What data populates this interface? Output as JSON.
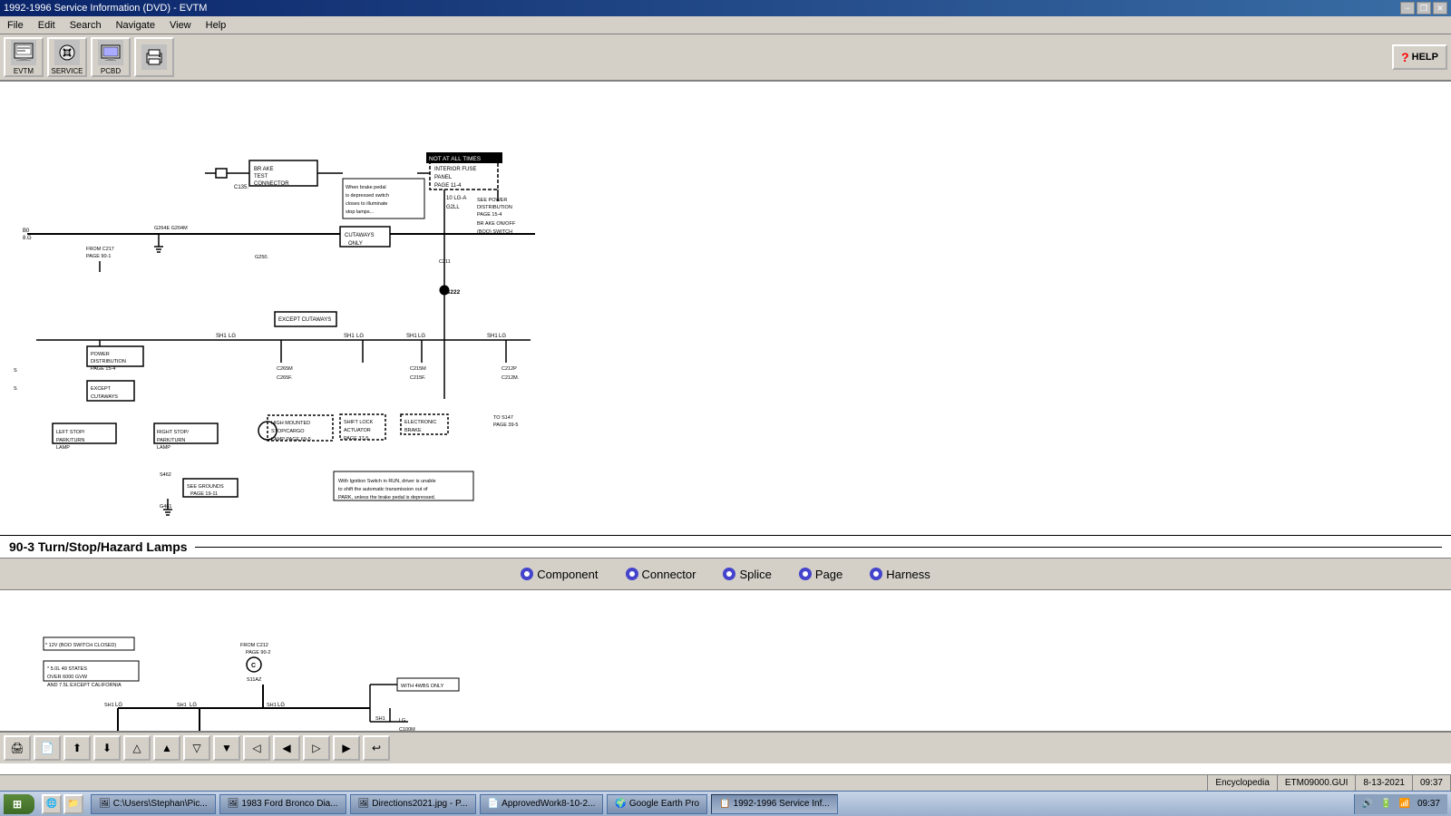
{
  "window": {
    "title": "1992-1996 Service Information (DVD) - EVTM",
    "minimize": "−",
    "restore": "❐",
    "close": "✕"
  },
  "menu": {
    "items": [
      "File",
      "Edit",
      "Search",
      "Navigate",
      "View",
      "Help"
    ]
  },
  "toolbar": {
    "buttons": [
      {
        "id": "evtm",
        "label": "EVTM",
        "icon": "📋"
      },
      {
        "id": "service",
        "label": "SERVICE",
        "icon": "🔧"
      },
      {
        "id": "pcbd",
        "label": "PCBD",
        "icon": "🖥"
      },
      {
        "id": "help2",
        "label": "",
        "icon": "❓"
      }
    ]
  },
  "help_btn": "HELP",
  "section_title": "90-3 Turn/Stop/Hazard Lamps",
  "nav_items": [
    "Component",
    "Connector",
    "Splice",
    "Page",
    "Harness"
  ],
  "bottom_toolbar": {
    "buttons": [
      "🖨",
      "📄",
      "⬆",
      "⬇",
      "△",
      "▲",
      "▽",
      "▼",
      "◁",
      "◀",
      "▷",
      "▶",
      "↩"
    ]
  },
  "status_bar": {
    "encyclopedia": "Encyclopedia",
    "gui": "ETM09000.GUI",
    "date": "8-13-2021",
    "time": "09:37"
  },
  "taskbar": {
    "apps": [
      {
        "label": "C:\\Users\\Stephan\\Pic...",
        "active": false
      },
      {
        "label": "1983 Ford Bronco Dia...",
        "active": false
      },
      {
        "label": "Directions2021.jpg - P...",
        "active": false
      },
      {
        "label": "ApprovedWork8-10-2...",
        "active": false
      },
      {
        "label": "Google Earth Pro",
        "active": false
      },
      {
        "label": "1992-1996 Service Inf...",
        "active": true
      }
    ]
  }
}
